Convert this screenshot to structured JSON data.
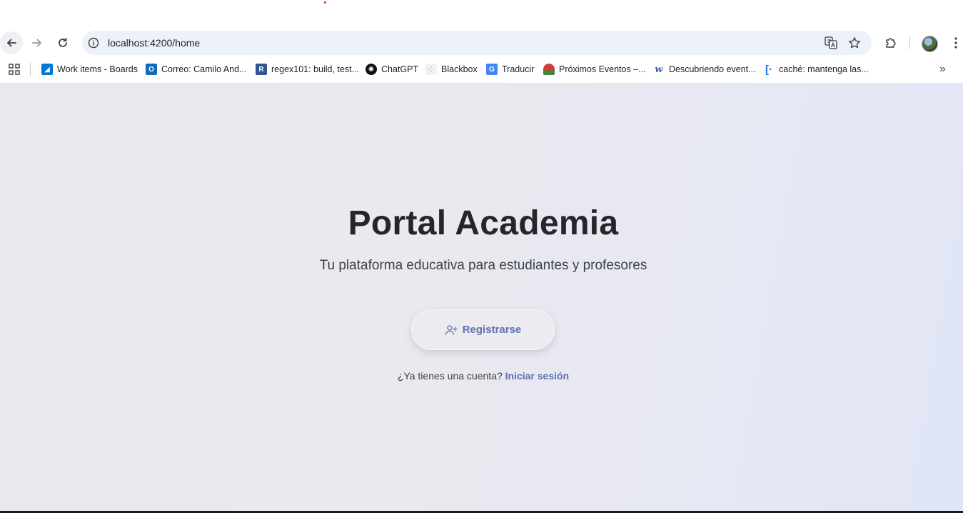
{
  "browser": {
    "url": "localhost:4200/home",
    "bookmarks": [
      {
        "label": "Work items - Boards",
        "icon": "azure-devops-icon",
        "color": "#0078d4"
      },
      {
        "label": "Correo: Camilo And...",
        "icon": "outlook-icon",
        "color": "#0f6cbd"
      },
      {
        "label": "regex101: build, test...",
        "icon": "regex101-icon",
        "color": "#2f5597"
      },
      {
        "label": "ChatGPT",
        "icon": "chatgpt-icon",
        "color": "#111111"
      },
      {
        "label": "Blackbox",
        "icon": "blackbox-icon",
        "color": "#dcdcdc"
      },
      {
        "label": "Traducir",
        "icon": "google-translate-icon",
        "color": "#4285f4"
      },
      {
        "label": "Próximos Eventos –...",
        "icon": "watermelon-icon",
        "color": "#d33a3a"
      },
      {
        "label": "Descubriendo event...",
        "icon": "wikipedia-w-icon",
        "color": "#3a5aa8"
      },
      {
        "label": "caché: mantenga las...",
        "icon": "bracket-icon",
        "color": "#1a73e8"
      }
    ]
  },
  "hero": {
    "title": "Portal Academia",
    "subtitle": "Tu plataforma educativa para estudiantes y profesores"
  },
  "actions": {
    "register_label": "Registrarse",
    "login_prompt": "¿Ya tienes una cuenta?",
    "login_link": "Iniciar sesión"
  },
  "colors": {
    "accent": "#5f72b2",
    "title": "#25262b"
  }
}
